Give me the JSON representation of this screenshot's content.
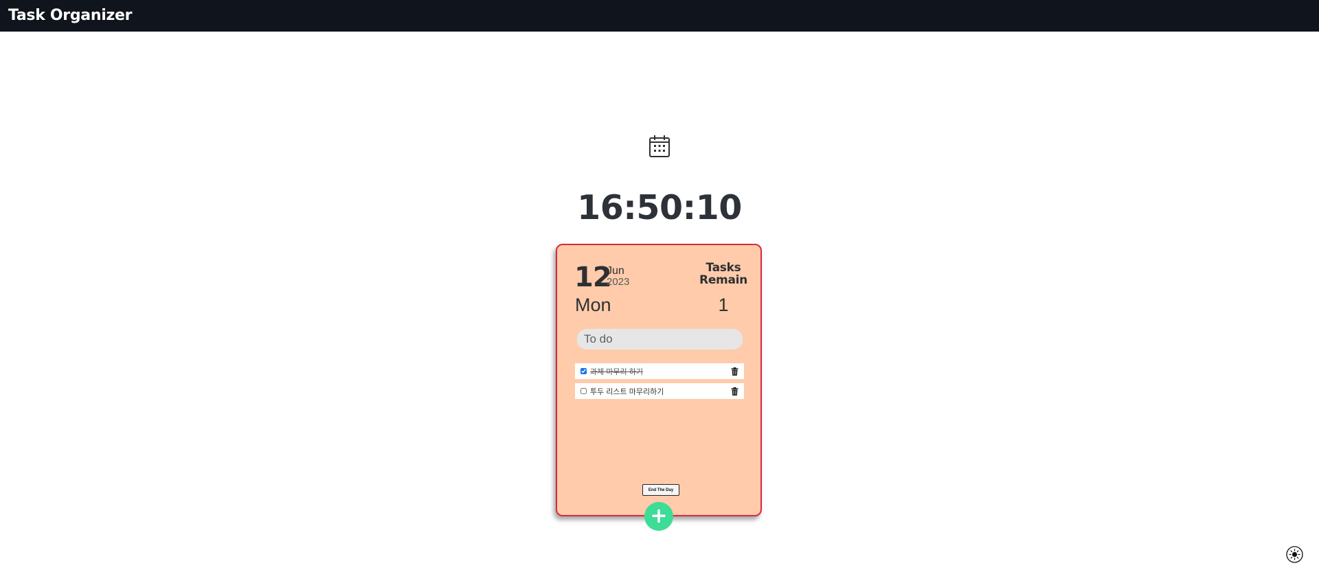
{
  "header": {
    "title": "Task Organizer"
  },
  "icons": {
    "calendar": "calendar-icon",
    "add": "plus",
    "trash": "trash-icon",
    "theme": "sun-icon"
  },
  "clock": {
    "time": "16:50:10"
  },
  "card": {
    "day": "12",
    "month": "Jun",
    "year": "2023",
    "weekday": "Mon",
    "tasks_remain_label": "Tasks Remain",
    "tasks_remain_count": "1",
    "todo_input": {
      "placeholder": "To do",
      "value": ""
    },
    "tasks": [
      {
        "text": "과제 마무리 하기",
        "done": true
      },
      {
        "text": "투두 리스트 마무리하기",
        "done": false
      }
    ],
    "end_day_label": "End The Day"
  },
  "add_button": {
    "label": "+"
  },
  "colors": {
    "topbar": "#10141d",
    "card_bg": "#ffcbaa",
    "card_border": "#d8293d",
    "add_button": "#3ddc97"
  }
}
